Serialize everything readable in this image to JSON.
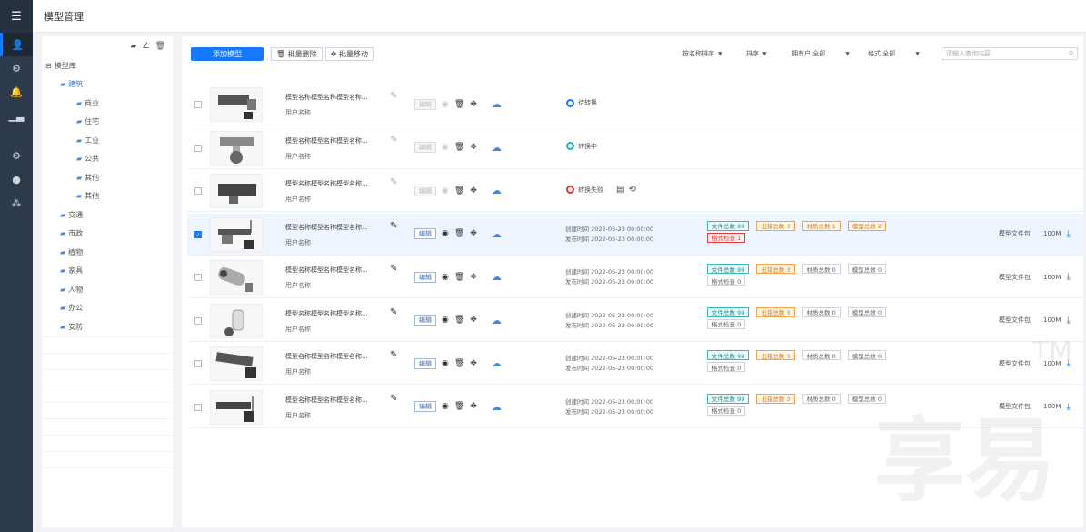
{
  "header": {
    "title": "模型管理"
  },
  "rail": {
    "items": [
      {
        "icon": "grid-icon"
      },
      {
        "icon": "person-icon"
      },
      {
        "icon": "model-icon"
      },
      {
        "icon": "bell-icon"
      },
      {
        "icon": "chart-icon"
      },
      {
        "icon": "settings-icon"
      },
      {
        "icon": "circle-icon"
      },
      {
        "icon": "users-icon"
      }
    ]
  },
  "tree": {
    "tools": [
      "▰",
      "∠",
      "🗑"
    ],
    "nodes": [
      {
        "label": "模型库",
        "level": 0
      },
      {
        "label": "建筑",
        "level": 1,
        "selected": true
      },
      {
        "label": "商业",
        "level": 2
      },
      {
        "label": "住宅",
        "level": 2
      },
      {
        "label": "工业",
        "level": 2
      },
      {
        "label": "公共",
        "level": 2
      },
      {
        "label": "其他",
        "level": 2
      },
      {
        "label": "其他",
        "level": 2
      },
      {
        "label": "交通",
        "level": 1
      },
      {
        "label": "市政",
        "level": 1
      },
      {
        "label": "植物",
        "level": 1
      },
      {
        "label": "家具",
        "level": 1
      },
      {
        "label": "人物",
        "level": 1
      },
      {
        "label": "办公",
        "level": 1
      },
      {
        "label": "安防",
        "level": 1
      }
    ]
  },
  "toolbar": {
    "add_label": "添加模型",
    "batch_delete": "批量删除",
    "batch_move": "批量移动",
    "filters": [
      {
        "label": "按名称排序",
        "value": ""
      },
      {
        "label": "排序",
        "value": ""
      },
      {
        "label": "拥有户",
        "value": "全部"
      },
      {
        "label": "格式",
        "value": "全部"
      }
    ],
    "search_placeholder": "请输入查询内容"
  },
  "rows": [
    {
      "name": "模型名称模型名称模型名称...",
      "owner": "用户名称",
      "edit_label": "编辑",
      "status_text": "待转换",
      "status_color": "blue",
      "disabled": true,
      "selected": false,
      "has_meta": false
    },
    {
      "name": "模型名称模型名称模型名称...",
      "owner": "用户名称",
      "edit_label": "编辑",
      "status_text": "转换中",
      "status_color": "teal",
      "disabled": true,
      "selected": false,
      "has_meta": false
    },
    {
      "name": "模型名称模型名称模型名称...",
      "owner": "用户名称",
      "edit_label": "编辑",
      "status_text": "转换失败",
      "status_color": "red",
      "disabled": true,
      "selected": false,
      "has_meta": false,
      "extra_icons": true
    },
    {
      "name": "模型名称模型名称模型名称...",
      "owner": "用户名称",
      "edit_label": "编辑",
      "selected": true,
      "has_meta": true,
      "created": "创建时间 2022-05-23 00:00:00",
      "published": "发布时间 2022-05-23 00:00:00",
      "tags": [
        {
          "text": "文件总数 99",
          "kind": "t"
        },
        {
          "text": "出错总数 3",
          "kind": "o"
        },
        {
          "text": "材质总数 1",
          "kind": "o"
        },
        {
          "text": "模型总数 2",
          "kind": "o"
        },
        {
          "text": "格式检查 1",
          "kind": "r"
        }
      ],
      "file_label": "模型文件包",
      "size": "100M"
    },
    {
      "name": "模型名称模型名称模型名称...",
      "owner": "用户名称",
      "edit_label": "编辑",
      "selected": false,
      "has_meta": true,
      "created": "创建时间 2022-05-23 00:00:00",
      "published": "发布时间 2022-05-23 00:00:00",
      "tags": [
        {
          "text": "文件总数 99",
          "kind": "t"
        },
        {
          "text": "出错总数 3",
          "kind": "o"
        },
        {
          "text": "材质总数 0",
          "kind": "g"
        },
        {
          "text": "模型总数 0",
          "kind": "g"
        },
        {
          "text": "格式检查 0",
          "kind": "g"
        }
      ],
      "file_label": "模型文件包",
      "size": "100M"
    },
    {
      "name": "模型名称模型名称模型名称...",
      "owner": "用户名称",
      "edit_label": "编辑",
      "selected": false,
      "has_meta": true,
      "created": "创建时间 2022-05-23 00:00:00",
      "published": "发布时间 2022-05-23 00:00:00",
      "tags": [
        {
          "text": "文件总数 99",
          "kind": "t"
        },
        {
          "text": "出错总数 3",
          "kind": "o"
        },
        {
          "text": "材质总数 0",
          "kind": "g"
        },
        {
          "text": "模型总数 0",
          "kind": "g"
        },
        {
          "text": "格式检查 0",
          "kind": "g"
        }
      ],
      "file_label": "模型文件包",
      "size": "100M"
    },
    {
      "name": "模型名称模型名称模型名称...",
      "owner": "用户名称",
      "edit_label": "编辑",
      "selected": false,
      "has_meta": true,
      "created": "创建时间 2022-05-23 00:00:00",
      "published": "发布时间 2022-05-23 00:00:00",
      "tags": [
        {
          "text": "文件总数 99",
          "kind": "t"
        },
        {
          "text": "出错总数 3",
          "kind": "o"
        },
        {
          "text": "材质总数 0",
          "kind": "g"
        },
        {
          "text": "模型总数 0",
          "kind": "g"
        },
        {
          "text": "格式检查 0",
          "kind": "g"
        }
      ],
      "file_label": "模型文件包",
      "size": "100M"
    },
    {
      "name": "模型名称模型名称模型名称...",
      "owner": "用户名称",
      "edit_label": "编辑",
      "selected": false,
      "has_meta": true,
      "created": "创建时间 2022-05-23 00:00:00",
      "published": "发布时间 2022-05-23 00:00:00",
      "tags": [
        {
          "text": "文件总数 99",
          "kind": "t"
        },
        {
          "text": "出错总数 3",
          "kind": "o"
        },
        {
          "text": "材质总数 0",
          "kind": "g"
        },
        {
          "text": "模型总数 0",
          "kind": "g"
        },
        {
          "text": "格式检查 0",
          "kind": "g"
        }
      ],
      "file_label": "模型文件包",
      "size": "100M"
    }
  ],
  "watermark": "享易",
  "watermark_tm": "TM"
}
